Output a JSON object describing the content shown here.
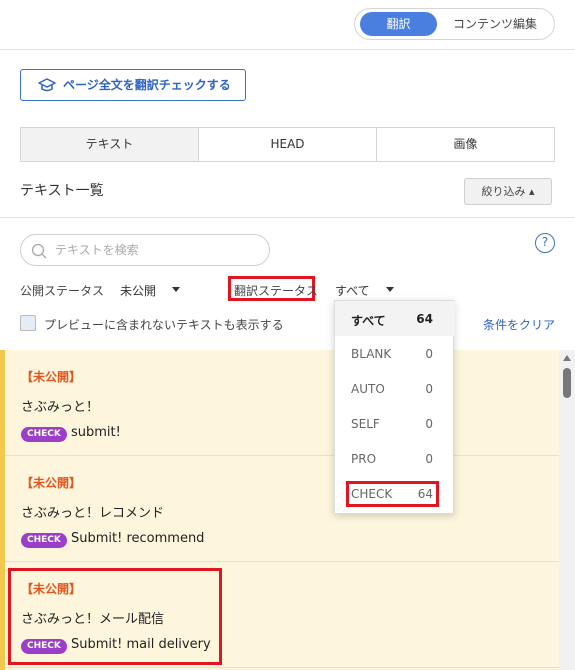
{
  "header": {
    "mode_active": "翻訳",
    "mode_inactive": "コンテンツ編集"
  },
  "check_page_button": {
    "label": "ページ全文を翻訳チェックする",
    "icon": "graduation-cap-icon"
  },
  "tabs": [
    {
      "label": "テキスト",
      "active": true
    },
    {
      "label": "HEAD",
      "active": false
    },
    {
      "label": "画像",
      "active": false
    }
  ],
  "list": {
    "title": "テキスト一覧",
    "filter_button": "絞り込み ▴"
  },
  "search": {
    "placeholder": "テキストを検索",
    "value": ""
  },
  "help": {
    "label": "?"
  },
  "filters": {
    "publish_status_label": "公開ステータス",
    "publish_status_value": "未公開",
    "translation_status_label": "翻訳ステータス",
    "translation_status_value": "すべて",
    "preview_checkbox_label": "プレビューに含まれないテキストも表示する",
    "preview_checked": false,
    "clear_link": "条件をクリア"
  },
  "dropdown": {
    "options": [
      {
        "name": "すべて",
        "count": "64",
        "selected": true
      },
      {
        "name": "BLANK",
        "count": "0",
        "selected": false
      },
      {
        "name": "AUTO",
        "count": "0",
        "selected": false
      },
      {
        "name": "SELF",
        "count": "0",
        "selected": false
      },
      {
        "name": "PRO",
        "count": "0",
        "selected": false
      },
      {
        "name": "CHECK",
        "count": "64",
        "selected": false
      }
    ]
  },
  "rows": [
    {
      "status": "【未公開】",
      "source": "さぶみっと！",
      "badge": "CHECK",
      "translation": "submit!"
    },
    {
      "status": "【未公開】",
      "source": "さぶみっと！レコメンド",
      "badge": "CHECK",
      "translation": "Submit! recommend"
    },
    {
      "status": "【未公開】",
      "source": "さぶみっと！メール配信",
      "badge": "CHECK",
      "translation": "Submit! mail delivery"
    }
  ],
  "colors": {
    "accent": "#4a7fe0",
    "link": "#2f63c4",
    "badge": "#9b3ec8",
    "status_text": "#e0561f",
    "row_background": "#fdf6dd",
    "highlight_box": "#e0151f"
  }
}
